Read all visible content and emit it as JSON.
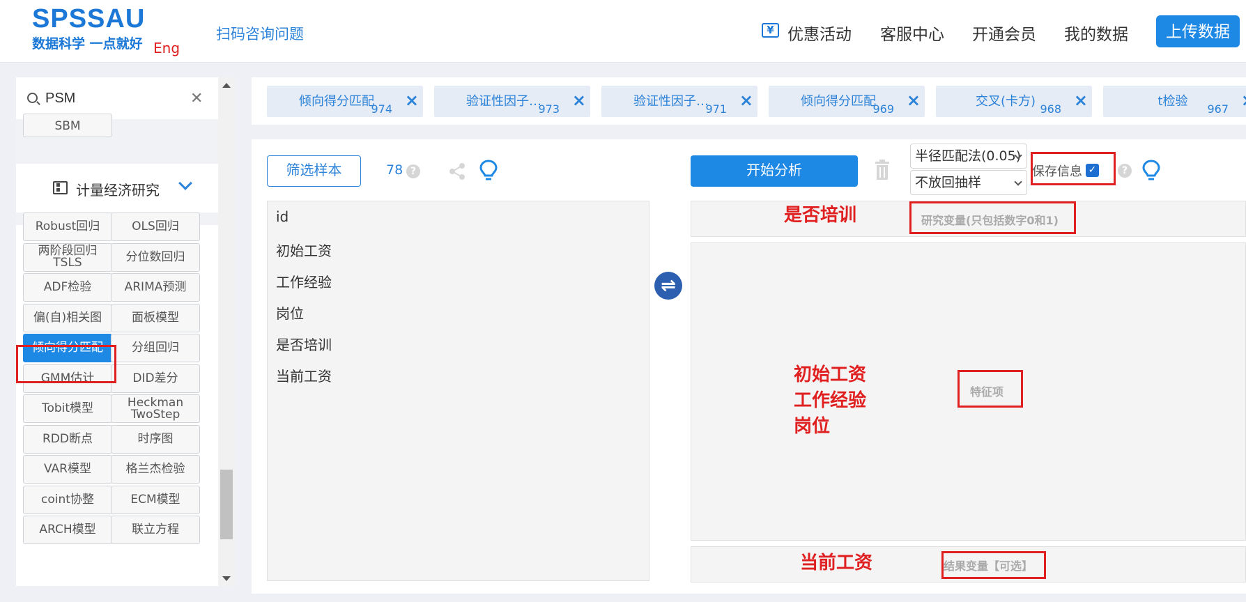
{
  "header": {
    "logo": "SPSSAU",
    "tagline": "数据科学 一点就好",
    "eng": "Eng",
    "scan": "扫码咨询问题",
    "nav": [
      "优惠活动",
      "客服中心",
      "开通会员",
      "我的数据"
    ],
    "upload": "上传数据"
  },
  "sidebar": {
    "search_value": "PSM",
    "sbm": "SBM",
    "category": "计量经济研究",
    "buttons": [
      "Robust回归",
      "OLS回归",
      "两阶段回归\nTSLS",
      "分位数回归",
      "ADF检验",
      "ARIMA预测",
      "偏(自)相关图",
      "面板模型",
      "倾向得分匹配",
      "分组回归",
      "GMM估计",
      "DID差分",
      "Tobit模型",
      "Heckman\nTwoStep",
      "RDD断点",
      "时序图",
      "VAR模型",
      "格兰杰检验",
      "coint协整",
      "ECM模型",
      "ARCH模型",
      "联立方程"
    ]
  },
  "tabs": [
    {
      "label": "倾向得分匹配",
      "num": "974"
    },
    {
      "label": "验证性因子…",
      "num": "973"
    },
    {
      "label": "验证性因子…",
      "num": "971"
    },
    {
      "label": "倾向得分匹配",
      "num": "969"
    },
    {
      "label": "交叉(卡方)",
      "num": "968"
    },
    {
      "label": "t检验",
      "num": "967"
    }
  ],
  "main": {
    "filter": "筛选样本",
    "count": "78",
    "start": "开始分析",
    "select1": "半径匹配法(0.05)",
    "select2": "不放回抽样",
    "save_label": "保存信息",
    "variables": [
      "id",
      "初始工资",
      "工作经验",
      "岗位",
      "是否培训",
      "当前工资"
    ],
    "research_hint": "研究变量(只包括数字0和1)",
    "feature_hint": "特征项",
    "result_hint": "结果变量【可选】"
  },
  "annotations": {
    "research": "是否培训",
    "features": [
      "初始工资",
      "工作经验",
      "岗位"
    ],
    "result": "当前工资"
  },
  "colors": {
    "accent": "#1e88e5",
    "annotation": "#e02020"
  }
}
